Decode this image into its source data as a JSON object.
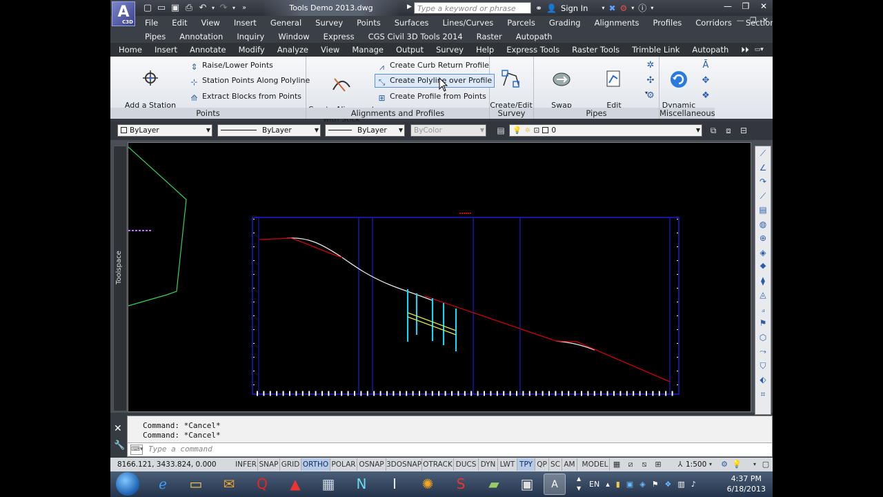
{
  "app": {
    "logo_text": "A",
    "logo_sub": "C3D",
    "document_title": "Tools Demo 2013.dwg",
    "search_placeholder": "Type a keyword or phrase",
    "sign_in": "Sign In"
  },
  "menubar": {
    "row1": [
      "File",
      "Edit",
      "View",
      "Insert",
      "General",
      "Survey",
      "Points",
      "Surfaces",
      "Lines/Curves",
      "Parcels",
      "Grading",
      "Alignments",
      "Profiles",
      "Corridors",
      "Sections"
    ],
    "row2": [
      "Pipes",
      "Annotation",
      "Inquiry",
      "Window",
      "Express",
      "CGS Civil 3D Tools 2014",
      "Raster",
      "Autopath"
    ]
  },
  "ribbon_tabs": [
    "Home",
    "Insert",
    "Annotate",
    "Modify",
    "Analyze",
    "View",
    "Manage",
    "Output",
    "Survey",
    "Help",
    "Express Tools",
    "Raster Tools",
    "Trimble Link",
    "Autopath"
  ],
  "ribbon": {
    "points": {
      "title": "Points",
      "add_station": "Add a Station\nand Offset to Points",
      "raise_lower": "Raise/Lower Points",
      "station_points": "Station Points Along Polyline",
      "extract_blocks": "Extract Blocks from Points"
    },
    "alignments": {
      "title": "Alignments and Profiles",
      "create_alignment": "Create Alignment\nwith Stick Method",
      "curb_return": "Create Curb Return Profile",
      "polyline_over_profile": "Create Polyline over Profile",
      "profile_from_points": "Create Profile from Points"
    },
    "survey": {
      "title": "Survey",
      "create_edit_traverse": "Create/Edit\nTraverse"
    },
    "pipes": {
      "title": "Pipes",
      "swap_parts": "Swap\nMultiple Parts",
      "edit_pipe_profile": "Edit\nPipe Profile"
    },
    "misc": {
      "title": "Miscellaneous",
      "dynamic_updates": "Dynamic\nUpdates"
    }
  },
  "properties": {
    "layer": "ByLayer",
    "linetype": "ByLayer",
    "lineweight": "ByLayer",
    "color": "ByColor",
    "current_layer": "0"
  },
  "toolspace_label": "Toolspace",
  "command_line": {
    "history": [
      "Command: *Cancel*",
      "Command: *Cancel*"
    ],
    "placeholder": "Type a command"
  },
  "status_bar": {
    "coordinates": "8166.121, 3433.824, 0.000",
    "toggles": [
      {
        "label": "INFER",
        "on": false
      },
      {
        "label": "SNAP",
        "on": false
      },
      {
        "label": "GRID",
        "on": false
      },
      {
        "label": "ORTHO",
        "on": true
      },
      {
        "label": "POLAR",
        "on": false
      },
      {
        "label": "OSNAP",
        "on": false
      },
      {
        "label": "3DOSNAP",
        "on": false
      },
      {
        "label": "OTRACK",
        "on": false
      },
      {
        "label": "DUCS",
        "on": false
      },
      {
        "label": "DYN",
        "on": false
      },
      {
        "label": "LWT",
        "on": false
      },
      {
        "label": "TPY",
        "on": true
      },
      {
        "label": "QP",
        "on": false
      },
      {
        "label": "SC",
        "on": false
      },
      {
        "label": "AM",
        "on": false
      }
    ],
    "space": "MODEL",
    "scale": "1:500"
  },
  "taskbar": {
    "language": "EN",
    "time": "4:37 PM",
    "date": "6/18/2013"
  },
  "colors": {
    "ribbon_bg": "#eef0f4",
    "highlight_border": "#5b8ed8",
    "profile_red": "#d10000",
    "grid_blue": "#1e1ed2",
    "pipe_cyan": "#00e0ff",
    "alignment_green": "#2fd65a"
  }
}
